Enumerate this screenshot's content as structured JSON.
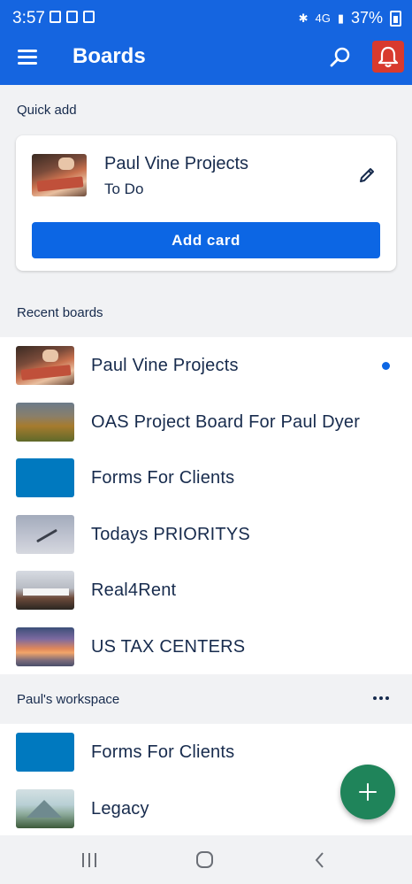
{
  "status_bar": {
    "time": "3:57",
    "network": "4G",
    "battery": "37%"
  },
  "app_bar": {
    "title": "Boards",
    "icons": [
      "menu-icon",
      "search-icon",
      "bell-icon"
    ]
  },
  "quick_add": {
    "label": "Quick add",
    "board": "Paul Vine Projects",
    "list": "To Do",
    "button": "Add card"
  },
  "recent_boards": {
    "label": "Recent boards",
    "items": [
      {
        "name": "Paul Vine Projects",
        "unread": true
      },
      {
        "name": "OAS Project Board For Paul Dyer"
      },
      {
        "name": "Forms For Clients"
      },
      {
        "name": "Todays PRIORITYS"
      },
      {
        "name": "Real4Rent"
      },
      {
        "name": "US TAX CENTERS"
      }
    ]
  },
  "workspace": {
    "label": "Paul's workspace",
    "items": [
      {
        "name": "Forms For Clients"
      },
      {
        "name": "Legacy"
      }
    ]
  },
  "colors": {
    "app_bar": "#1565e0",
    "primary_button": "#0c66e4",
    "notification": "#d83a2e",
    "fab": "#1f845a",
    "board_blue": "#0079bf"
  }
}
